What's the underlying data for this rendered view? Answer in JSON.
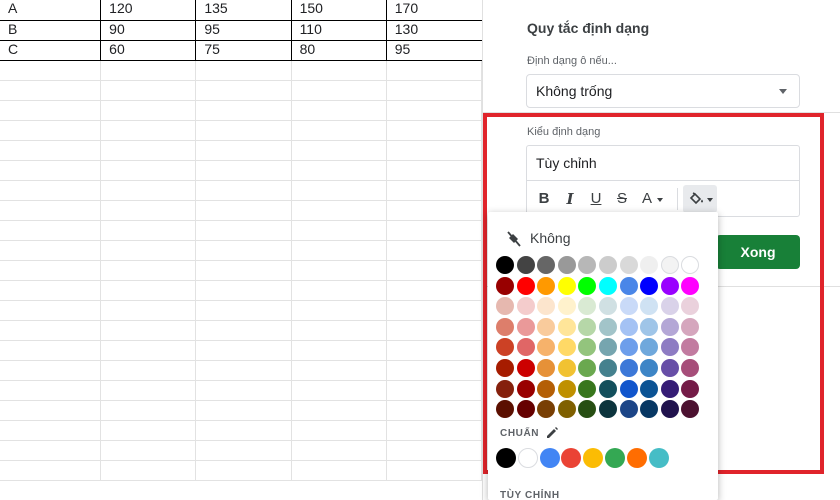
{
  "sheet": {
    "rows": [
      [
        "A",
        "120",
        "135",
        "150",
        "170"
      ],
      [
        "B",
        "90",
        "95",
        "110",
        "130"
      ],
      [
        "C",
        "60",
        "75",
        "80",
        "95"
      ]
    ],
    "empty_rows": 21
  },
  "panel": {
    "title": "Quy tắc định dạng",
    "condition_label": "Định dạng ô nếu...",
    "condition_value": "Không trống",
    "style_label": "Kiểu định dạng",
    "style_value": "Tùy chỉnh",
    "toolbar": {
      "bold": "B",
      "italic": "I",
      "underline": "U",
      "strikethrough": "S",
      "text_color": "A"
    },
    "done_label": "Xong"
  },
  "picker": {
    "none_label": "Không",
    "standard_label": "CHUẨN",
    "custom_label": "TÙY CHỈNH",
    "palette": [
      [
        "#000000",
        "#434343",
        "#666666",
        "#999999",
        "#b7b7b7",
        "#cccccc",
        "#d9d9d9",
        "#efefef",
        "#f3f3f3",
        "#ffffff"
      ],
      [
        "#980000",
        "#ff0000",
        "#ff9900",
        "#ffff00",
        "#00ff00",
        "#00ffff",
        "#4a86e8",
        "#0000ff",
        "#9900ff",
        "#ff00ff"
      ],
      [
        "#e6b8af",
        "#f4cccc",
        "#fce5cd",
        "#fff2cc",
        "#d9ead3",
        "#d0e0e3",
        "#c9daf8",
        "#cfe2f3",
        "#d9d2e9",
        "#ead1dc"
      ],
      [
        "#dd7e6b",
        "#ea9999",
        "#f9cb9c",
        "#ffe599",
        "#b6d7a8",
        "#a2c4c9",
        "#a4c2f4",
        "#9fc5e8",
        "#b4a7d6",
        "#d5a6bd"
      ],
      [
        "#cc4125",
        "#e06666",
        "#f6b26b",
        "#ffd966",
        "#93c47d",
        "#76a5af",
        "#6d9eeb",
        "#6fa8dc",
        "#8e7cc3",
        "#c27ba0"
      ],
      [
        "#a61c00",
        "#cc0000",
        "#e69138",
        "#f1c232",
        "#6aa84f",
        "#45818e",
        "#3c78d8",
        "#3d85c6",
        "#674ea7",
        "#a64d79"
      ],
      [
        "#85200c",
        "#990000",
        "#b45f06",
        "#bf9000",
        "#38761d",
        "#134f5c",
        "#1155cc",
        "#0b5394",
        "#351c75",
        "#741b47"
      ],
      [
        "#5b0f00",
        "#660000",
        "#783f04",
        "#7f6000",
        "#274e13",
        "#0c343d",
        "#1c4587",
        "#073763",
        "#20124d",
        "#4c1130"
      ]
    ],
    "standard": [
      "#000000",
      "#ffffff",
      "#4285f4",
      "#ea4335",
      "#fbbc04",
      "#34a853",
      "#ff6d01",
      "#46bdc6"
    ]
  },
  "colors": {
    "accent_green": "#188038",
    "highlight_red": "#e0242b"
  }
}
